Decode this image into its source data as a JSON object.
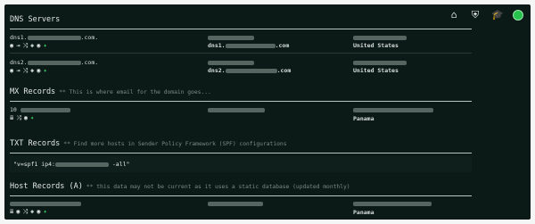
{
  "toolbar": {
    "icons": [
      "home-icon",
      "shield-icon",
      "graduation-cap-icon",
      "status-dot-icon"
    ],
    "glyphs": {
      "home": "⌂",
      "shield": "⛨",
      "cap": "🎓"
    }
  },
  "dns": {
    "title": "DNS Servers",
    "rows": [
      {
        "name": "dns1.",
        "suffix": ".com.",
        "host": "dns1.",
        "host_suffix": ".com",
        "country": "United States"
      },
      {
        "name": "dns2.",
        "suffix": ".com.",
        "host": "dns2.",
        "host_suffix": ".com",
        "country": "United States"
      }
    ]
  },
  "mx": {
    "title": "MX Records",
    "note": "** This is where email for the domain goes...",
    "priority": "10",
    "country": "Panama"
  },
  "txt": {
    "title": "TXT Records",
    "note": "** Find more hosts in Sender Policy Framework (SPF) configurations",
    "value_prefix": "\"v=spf1 ip4:",
    "value_suffix": " -all\""
  },
  "host": {
    "title": "Host Records (A)",
    "note": "** this data may not be current as it uses a static database (updated monthly)",
    "country": "Panama"
  },
  "row_icons": {
    "globe": "◉",
    "signin": "⇥",
    "shuffle": "⤨",
    "map": "◈",
    "eye": "◉",
    "plus": "✦",
    "list": "≣"
  }
}
